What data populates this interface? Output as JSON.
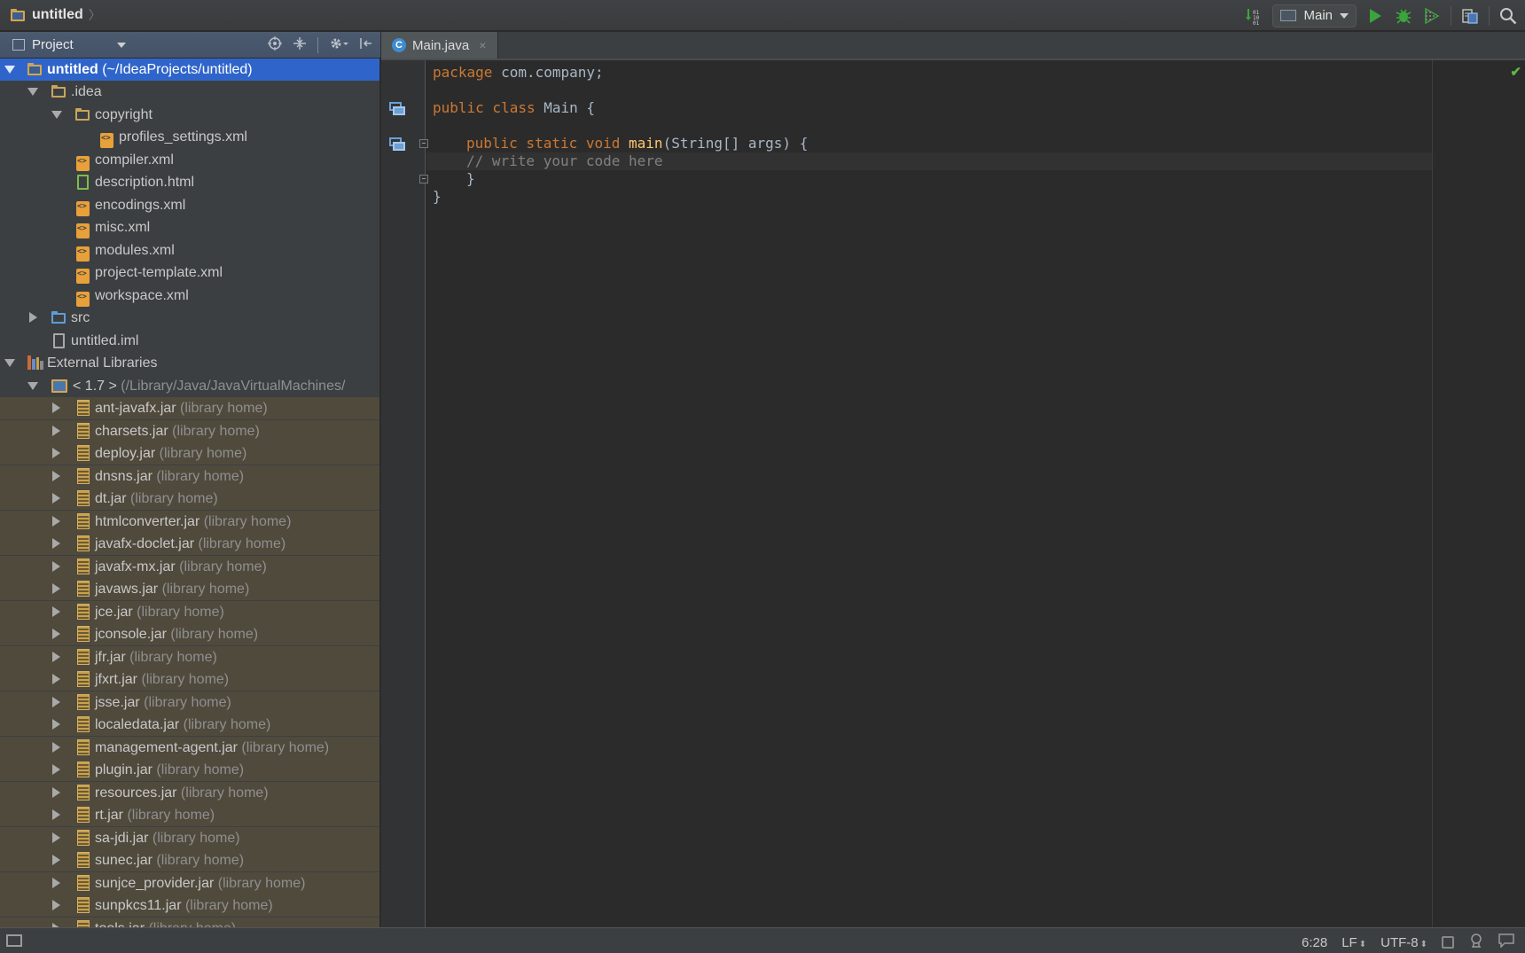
{
  "navbar": {
    "title": "untitled",
    "separator": "〉",
    "run_config": "Main"
  },
  "icons": {
    "build": "build-icon",
    "run": "run-icon",
    "debug": "debug-icon",
    "coverage": "coverage-icon",
    "structure": "project-structure-icon",
    "search": "search-icon"
  },
  "colors": {
    "selection": "#2f65ca",
    "library_bg": "#504a3d",
    "keyword": "#cc7832",
    "method": "#ffc66d",
    "comment": "#808080",
    "run_green": "#3ba53b"
  },
  "project_panel": {
    "title": "Project"
  },
  "tree": [
    {
      "name": "untitled",
      "suffix": " (~/IdeaProjects/untitled)",
      "selected": true
    },
    {
      "name": ".idea"
    },
    {
      "name": "copyright"
    },
    {
      "name": "profiles_settings.xml"
    },
    {
      "name": "compiler.xml"
    },
    {
      "name": "description.html"
    },
    {
      "name": "encodings.xml"
    },
    {
      "name": "misc.xml"
    },
    {
      "name": "modules.xml"
    },
    {
      "name": "project-template.xml"
    },
    {
      "name": "workspace.xml"
    },
    {
      "name": "src"
    },
    {
      "name": "untitled.iml"
    },
    {
      "name": "External Libraries"
    },
    {
      "name": "< 1.7 >",
      "suffix": " (/Library/Java/JavaVirtualMachines/"
    }
  ],
  "libraries": {
    "suffix": " (library home)",
    "items": [
      "ant-javafx.jar",
      "charsets.jar",
      "deploy.jar",
      "dnsns.jar",
      "dt.jar",
      "htmlconverter.jar",
      "javafx-doclet.jar",
      "javafx-mx.jar",
      "javaws.jar",
      "jce.jar",
      "jconsole.jar",
      "jfr.jar",
      "jfxrt.jar",
      "jsse.jar",
      "localedata.jar",
      "management-agent.jar",
      "plugin.jar",
      "resources.jar",
      "rt.jar",
      "sa-jdi.jar",
      "sunec.jar",
      "sunjce_provider.jar",
      "sunpkcs11.jar",
      "tools.jar"
    ]
  },
  "editor": {
    "tab": "Main.java",
    "tab_icon": "C",
    "close": "×",
    "code": {
      "l1_kw": "package",
      "l1_rest": " com.company;",
      "l3_kw": "public class",
      "l3_rest": " Main {",
      "l5_kw": "public static void",
      "l5_fn": "main",
      "l5_rest": "(String[] args) {",
      "l6_comment": "// write your code here",
      "l7": "}",
      "l8": "}"
    },
    "inspection_ok": "✔"
  },
  "status": {
    "position": "6:28",
    "line_sep": "LF",
    "encoding": "UTF-8",
    "updown": "⬍"
  }
}
